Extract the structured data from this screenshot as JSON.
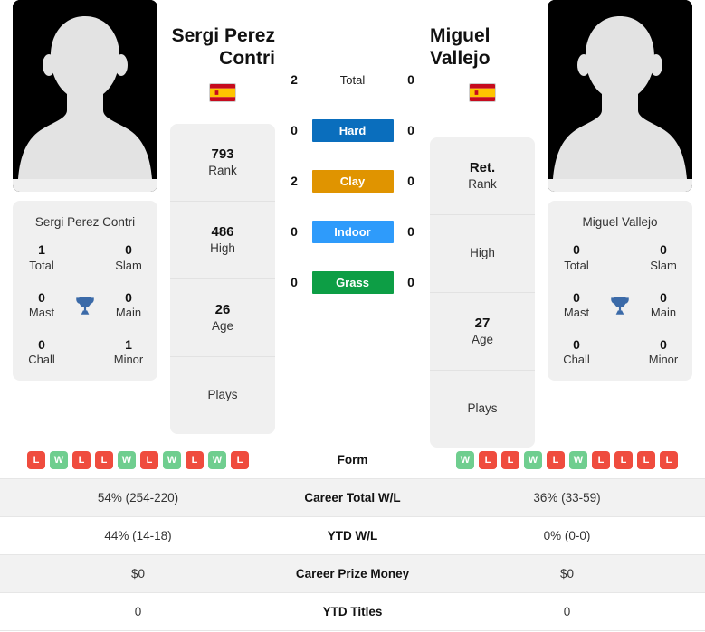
{
  "players": {
    "left": {
      "display_name_line1": "Sergi Perez",
      "display_name_line2": "Contri",
      "full_name": "Sergi Perez Contri",
      "country": "Spain",
      "flag": "spain-flag",
      "avatar": "player-silhouette",
      "titles": {
        "total_value": "1",
        "total_label": "Total",
        "slam_value": "0",
        "slam_label": "Slam",
        "mast_value": "0",
        "mast_label": "Mast",
        "main_value": "0",
        "main_label": "Main",
        "chall_value": "0",
        "chall_label": "Chall",
        "minor_value": "1",
        "minor_label": "Minor"
      },
      "ranking": {
        "rank_value": "793",
        "rank_label": "Rank",
        "high_value": "486",
        "high_label": "High",
        "age_value": "26",
        "age_label": "Age",
        "plays_value": "",
        "plays_label": "Plays"
      }
    },
    "right": {
      "display_name_line1": "Miguel",
      "display_name_line2": "Vallejo",
      "full_name": "Miguel Vallejo",
      "country": "Spain",
      "flag": "spain-flag",
      "avatar": "player-silhouette",
      "titles": {
        "total_value": "0",
        "total_label": "Total",
        "slam_value": "0",
        "slam_label": "Slam",
        "mast_value": "0",
        "mast_label": "Mast",
        "main_value": "0",
        "main_label": "Main",
        "chall_value": "0",
        "chall_label": "Chall",
        "minor_value": "0",
        "minor_label": "Minor"
      },
      "ranking": {
        "rank_value": "Ret.",
        "rank_label": "Rank",
        "high_value": "",
        "high_label": "High",
        "age_value": "27",
        "age_label": "Age",
        "plays_value": "",
        "plays_label": "Plays"
      }
    }
  },
  "h2h": {
    "rows": [
      {
        "label": "Total",
        "left": "2",
        "right": "0",
        "color": "",
        "badge": false
      },
      {
        "label": "Hard",
        "left": "0",
        "right": "0",
        "color": "#0a6ebd",
        "badge": true
      },
      {
        "label": "Clay",
        "left": "2",
        "right": "0",
        "color": "#e09400",
        "badge": true
      },
      {
        "label": "Indoor",
        "left": "0",
        "right": "0",
        "color": "#2e9bfb",
        "badge": true
      },
      {
        "label": "Grass",
        "left": "0",
        "right": "0",
        "color": "#0d9e45",
        "badge": true
      }
    ]
  },
  "compare": {
    "rows": [
      {
        "label": "Form",
        "type": "form",
        "left_form": [
          "L",
          "W",
          "L",
          "L",
          "W",
          "L",
          "W",
          "L",
          "W",
          "L"
        ],
        "right_form": [
          "W",
          "L",
          "L",
          "W",
          "L",
          "W",
          "L",
          "L",
          "L",
          "L"
        ],
        "left": "",
        "right": ""
      },
      {
        "label": "Career Total W/L",
        "type": "text",
        "left": "54% (254-220)",
        "right": "36% (33-59)"
      },
      {
        "label": "YTD W/L",
        "type": "text",
        "left": "44% (14-18)",
        "right": "0% (0-0)"
      },
      {
        "label": "Career Prize Money",
        "type": "text",
        "left": "$0",
        "right": "$0"
      },
      {
        "label": "YTD Titles",
        "type": "text",
        "left": "0",
        "right": "0"
      }
    ]
  },
  "colors": {
    "win": "#6fce8f",
    "loss": "#ef4c3e",
    "card_bg": "#f0f0f0",
    "trophy": "#3b6aa8"
  }
}
